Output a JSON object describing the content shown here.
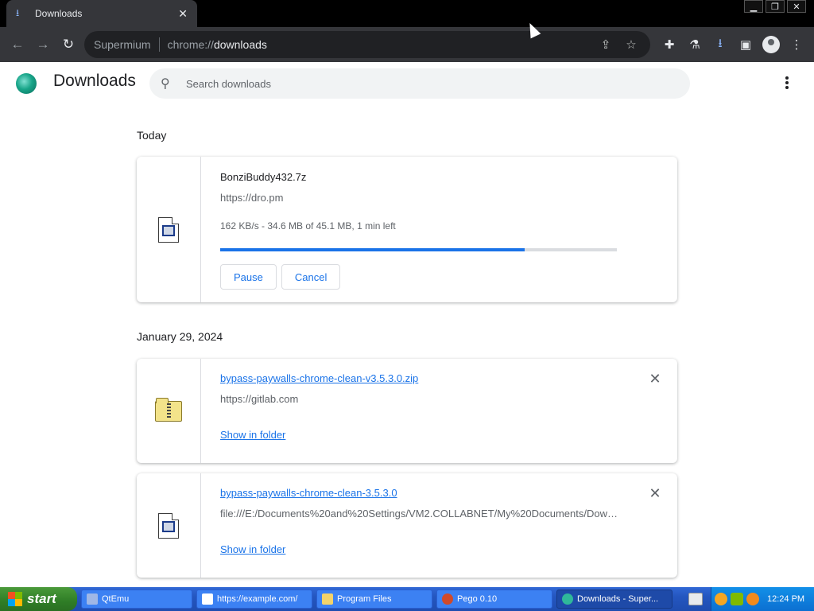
{
  "browser": {
    "tab_title": "Downloads",
    "brand": "Supermium",
    "url_scheme": "chrome://",
    "url_path": "downloads"
  },
  "page": {
    "title": "Downloads",
    "search_placeholder": "Search downloads"
  },
  "sections": [
    {
      "date": "Today",
      "items": [
        {
          "name": "BonziBuddy432.7z",
          "url": "https://dro.pm",
          "status": "162 KB/s - 34.6 MB of 45.1 MB, 1 min left",
          "progress_fraction": 0.767,
          "icon": "document-icon",
          "pause_label": "Pause",
          "cancel_label": "Cancel"
        }
      ]
    },
    {
      "date": "January 29, 2024",
      "items": [
        {
          "name": "bypass-paywalls-chrome-clean-v3.5.3.0.zip",
          "url": "https://gitlab.com",
          "action_label": "Show in folder",
          "icon": "zip-folder-icon",
          "remove_symbol": "✕"
        },
        {
          "name": "bypass-paywalls-chrome-clean-3.5.3.0",
          "url": "file:///E:/Documents%20and%20Settings/VM2.COLLABNET/My%20Documents/Down...",
          "action_label": "Show in folder",
          "icon": "document-icon",
          "remove_symbol": "✕"
        }
      ]
    }
  ],
  "taskbar": {
    "start_label": "start",
    "tasks": [
      {
        "label": "QtEmu",
        "icon_color": "#9fb7e6",
        "active": false
      },
      {
        "label": "https://example.com/",
        "icon_color": "#ffffff",
        "active": false
      },
      {
        "label": "Program Files",
        "icon_color": "#f3d36a",
        "active": false
      },
      {
        "label": "Pego 0.10",
        "icon_color": "#d04a2a",
        "active": false
      },
      {
        "label": "Downloads - Super...",
        "icon_color": "#2fb89a",
        "active": true
      }
    ],
    "clock": "12:24 PM"
  },
  "colors": {
    "accent": "#1a73e8",
    "toolbar": "#35363a",
    "taskbar": "#2456c0"
  }
}
